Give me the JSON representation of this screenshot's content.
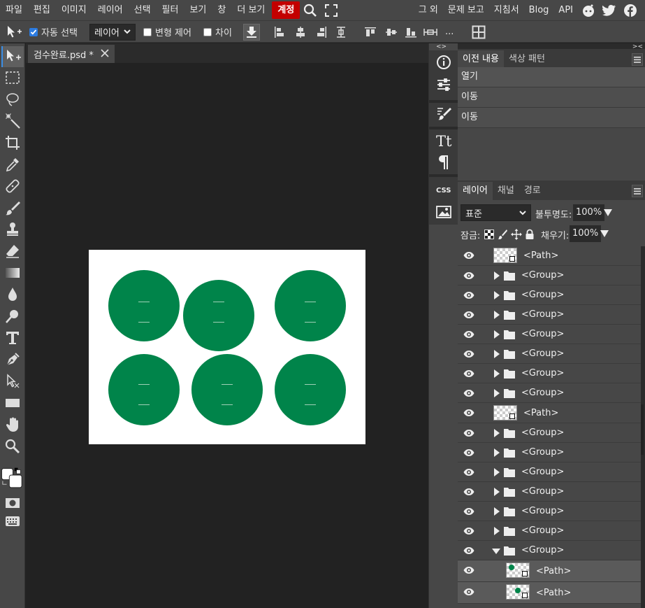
{
  "menu": {
    "items": [
      "파일",
      "편집",
      "이미지",
      "레이어",
      "선택",
      "필터",
      "보기",
      "창",
      "더 보기"
    ],
    "account": "계정",
    "right": [
      "그 외",
      "문제 보고",
      "지침서",
      "Blog",
      "API"
    ]
  },
  "options": {
    "auto_select_label": "자동 선택",
    "layer_select_value": "레이어",
    "transform_label": "변형 제어",
    "diff_label": "차이",
    "more": "..."
  },
  "document": {
    "tab_label": "검수완료.psd *"
  },
  "history_panel": {
    "tabs": [
      "이전 내용",
      "색상 패턴"
    ],
    "items": [
      "열기",
      "이동",
      "이동"
    ]
  },
  "layers_panel": {
    "tabs": [
      "레이어",
      "채널",
      "경로"
    ],
    "blend_mode": "표준",
    "opacity_label": "불투명도:",
    "opacity_value": "100%",
    "lock_label": "잠금:",
    "fill_label": "채우기:",
    "fill_value": "100%",
    "layers": [
      {
        "name": "<Path>",
        "kind": "path"
      },
      {
        "name": "<Group>",
        "kind": "group"
      },
      {
        "name": "<Group>",
        "kind": "group"
      },
      {
        "name": "<Group>",
        "kind": "group"
      },
      {
        "name": "<Group>",
        "kind": "group"
      },
      {
        "name": "<Group>",
        "kind": "group"
      },
      {
        "name": "<Group>",
        "kind": "group"
      },
      {
        "name": "<Group>",
        "kind": "group"
      },
      {
        "name": "<Path>",
        "kind": "path"
      },
      {
        "name": "<Group>",
        "kind": "group"
      },
      {
        "name": "<Group>",
        "kind": "group"
      },
      {
        "name": "<Group>",
        "kind": "group"
      },
      {
        "name": "<Group>",
        "kind": "group"
      },
      {
        "name": "<Group>",
        "kind": "group"
      },
      {
        "name": "<Group>",
        "kind": "group"
      },
      {
        "name": "<Group>",
        "kind": "group-open"
      },
      {
        "name": "<Path>",
        "kind": "child-path"
      },
      {
        "name": "<Path>",
        "kind": "child-path"
      }
    ]
  },
  "colors": {
    "circle_green": "#00844a",
    "account_red": "#c30000",
    "panel_bg": "#474747"
  }
}
